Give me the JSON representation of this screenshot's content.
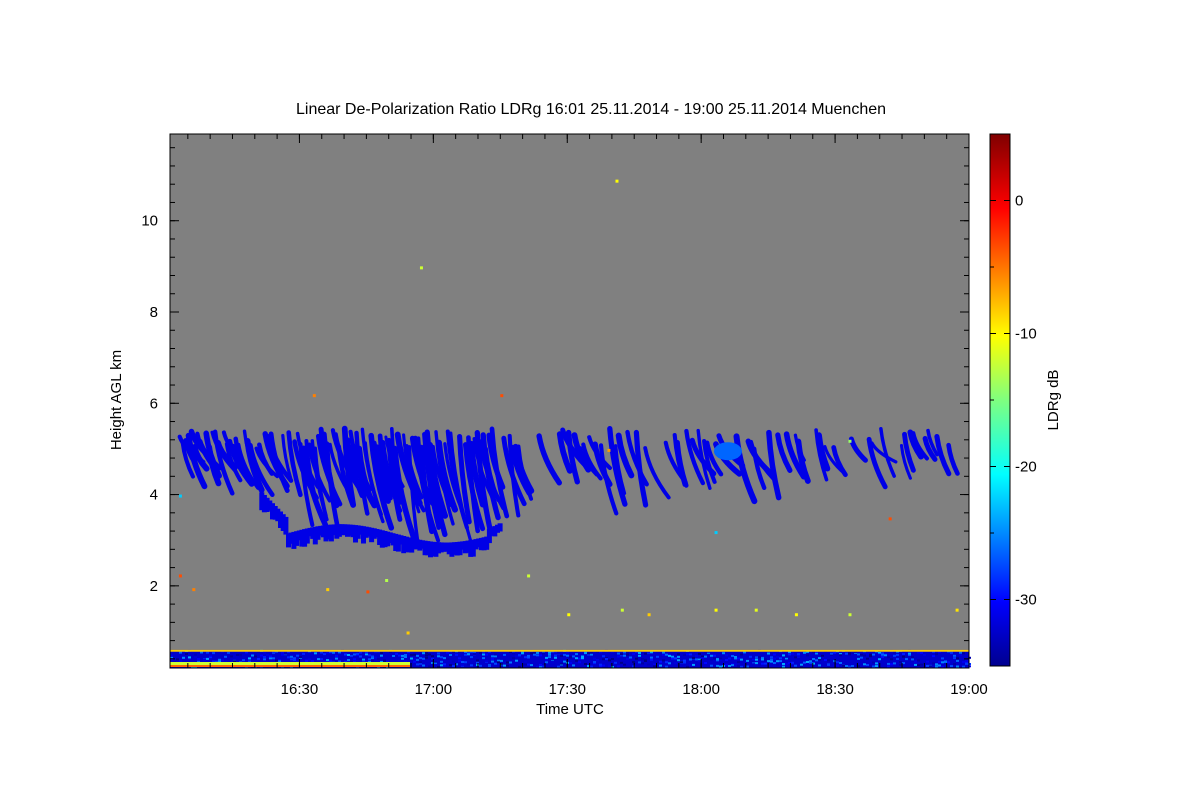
{
  "chart_data": {
    "type": "heatmap",
    "title": "Linear De-Polarization Ratio LDRg   16:01 25.11.2014 - 19:00 25.11.2014 Muenchen",
    "xlabel": "Time UTC",
    "ylabel": "Height AGL km",
    "xlim_hours": [
      16.0167,
      19.0
    ],
    "ylim_km": [
      0.2,
      11.9
    ],
    "x_ticks": [
      "16:30",
      "17:00",
      "17:30",
      "18:00",
      "18:30",
      "19:00"
    ],
    "y_ticks": [
      "2",
      "4",
      "6",
      "8",
      "10"
    ],
    "background_color": "#808080",
    "colorbar": {
      "label": "LDRg dB",
      "range_db": [
        -35,
        5
      ],
      "ticks": [
        "0",
        "-10",
        "-20",
        "-30"
      ],
      "colormap": "jet"
    },
    "features": [
      {
        "name": "ice cloud band (fall streaks)",
        "time_start_h": 16.02,
        "time_end_h": 18.95,
        "base_km": 2.8,
        "top_km": 5.4,
        "ldr_db": -31
      },
      {
        "name": "boundary layer aerosol",
        "time_start_h": 16.02,
        "time_end_h": 19.0,
        "base_km": 0.2,
        "top_km": 0.6,
        "ldr_db_range": [
          -32,
          -5
        ]
      },
      {
        "name": "isolated depolarizing patch",
        "time_h": 18.1,
        "height_km": 4.95,
        "ldr_db": -26
      }
    ]
  }
}
